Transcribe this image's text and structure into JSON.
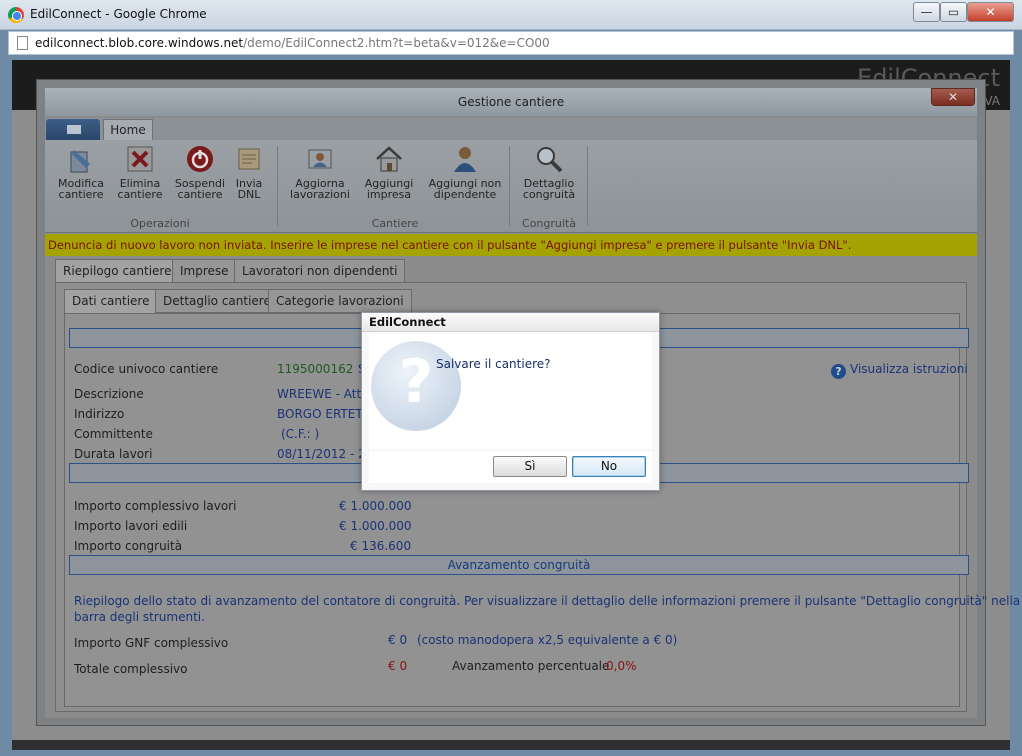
{
  "browser": {
    "title": "EdilConnect - Google Chrome",
    "url_host": "edilconnect.blob.core.windows.net",
    "url_path": "/demo/EdilConnect2.htm?t=beta&v=012&e=CO00",
    "min": "—",
    "max": "▭",
    "close": "✕"
  },
  "app": {
    "brand": "EdilConnect",
    "brand_sub": "VA"
  },
  "window": {
    "title": "Gestione cantiere",
    "close": "✕"
  },
  "ribbon": {
    "home_tab": "Home",
    "groups": {
      "operazioni": "Operazioni",
      "cantiere": "Cantiere",
      "congruita": "Congruità"
    },
    "buttons": {
      "modifica": "Modifica cantiere",
      "elimina": "Elimina cantiere",
      "sospendi": "Sospendi cantiere",
      "invia": "Invia DNL",
      "aggiorna": "Aggiorna lavorazioni",
      "aggiungi_impresa": "Aggiungi impresa",
      "aggiungi_non_dip": "Aggiungi non dipendente",
      "dettaglio_congruita": "Dettaglio congruità"
    }
  },
  "warning": "Denuncia di nuovo lavoro non inviata. Inserire le imprese nel cantiere con il pulsante \"Aggiungi impresa\" e premere il pulsante \"Invia DNL\".",
  "tabs": [
    "Riepilogo cantiere",
    "Imprese",
    "Lavoratori non dipendenti"
  ],
  "subtabs": [
    "Dati cantiere",
    "Dettaglio cantiere",
    "Categorie lavorazioni"
  ],
  "dati": {
    "codice_label": "Codice univoco cantiere",
    "codice_value": "1195000162",
    "codice_status": "St",
    "descrizione_label": "Descrizione",
    "descrizione_value": "WREEWE - Attivo",
    "indirizzo_label": "Indirizzo",
    "indirizzo_value": "BORGO ERTET E",
    "committente_label": "Committente",
    "committente_value": "(C.F.: )",
    "durata_label": "Durata lavori",
    "durata_value": "08/11/2012 - 29",
    "istruzioni": "Visualizza istruzioni"
  },
  "importi": {
    "complessivo_label": "Importo complessivo lavori",
    "complessivo_value": "€ 1.000.000",
    "edili_label": "Importo lavori edili",
    "edili_value": "€ 1.000.000",
    "congruita_label": "Importo congruità",
    "congruita_value": "€ 136.600"
  },
  "avanzamento": {
    "section_title": "Avanzamento congruità",
    "description": "Riepilogo dello stato di avanzamento del contatore di congruità. Per visualizzare il dettaglio delle informazioni premere il pulsante \"Dettaglio congruità\" nella",
    "description2": "barra degli strumenti.",
    "gnf_label": "Importo GNF complessivo",
    "gnf_value": "€ 0",
    "gnf_note": "(costo manodopera x2,5 equivalente a € 0)",
    "totale_label": "Totale complessivo",
    "totale_value": "€ 0",
    "percent_label": "Avanzamento percentuale",
    "percent_value": "0,0%"
  },
  "modal": {
    "title": "EdilConnect",
    "message": "Salvare il cantiere?",
    "icon_glyph": "?",
    "yes": "Sì",
    "no": "No"
  }
}
